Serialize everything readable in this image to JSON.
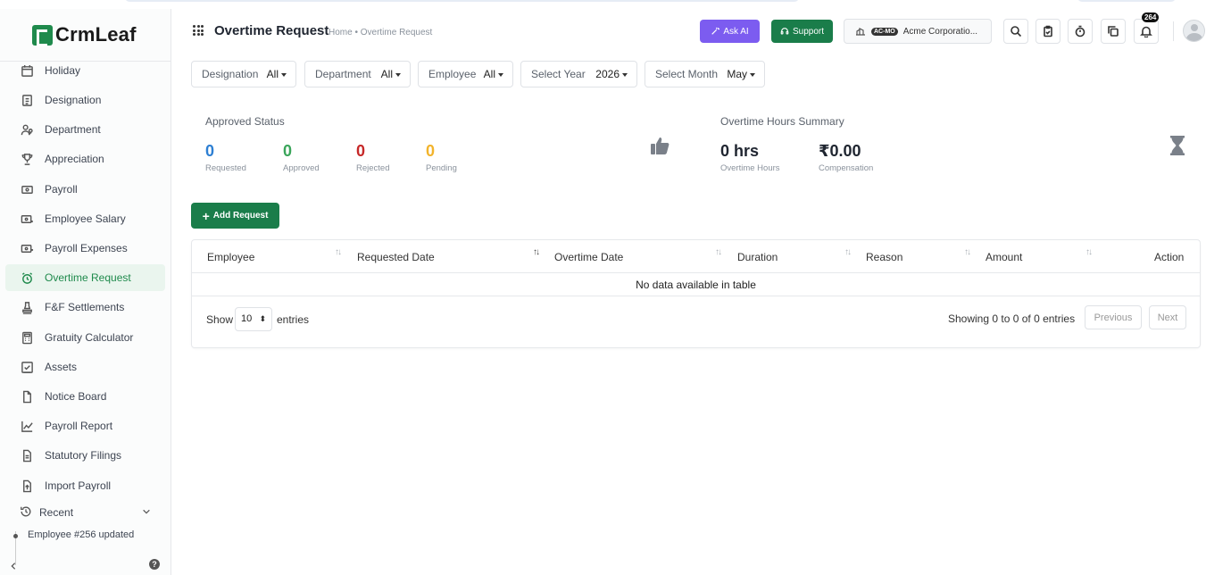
{
  "app": {
    "brand": "CrmLeaf"
  },
  "sidebar": {
    "items": [
      {
        "label": "Holiday",
        "icon": "calendar-icon"
      },
      {
        "label": "Designation",
        "icon": "id-card-icon"
      },
      {
        "label": "Department",
        "icon": "users-icon"
      },
      {
        "label": "Appreciation",
        "icon": "trophy-icon"
      },
      {
        "label": "Payroll",
        "icon": "money-icon"
      },
      {
        "label": "Employee Salary",
        "icon": "salary-icon"
      },
      {
        "label": "Payroll Expenses",
        "icon": "expenses-icon"
      },
      {
        "label": "Overtime Request",
        "icon": "alarm-clock-icon",
        "active": true
      },
      {
        "label": "F&F Settlements",
        "icon": "stamp-icon"
      },
      {
        "label": "Gratuity Calculator",
        "icon": "calculator-icon"
      },
      {
        "label": "Assets",
        "icon": "check-square-icon"
      },
      {
        "label": "Notice Board",
        "icon": "file-icon"
      },
      {
        "label": "Payroll Report",
        "icon": "chart-line-icon"
      },
      {
        "label": "Statutory Filings",
        "icon": "document-icon"
      },
      {
        "label": "Import Payroll",
        "icon": "upload-file-icon"
      }
    ],
    "recent_label": "Recent",
    "recent_items": [
      "Employee #256 updated"
    ]
  },
  "header": {
    "title": "Overtime Request",
    "breadcrumb": "Home • Overtime Request",
    "ask_ai": "Ask AI",
    "support": "Support",
    "company_badge": "AC-MO",
    "company_name": "Acme Corporatio...",
    "notification_count": "264"
  },
  "filters": [
    {
      "label": "Designation",
      "value": "All"
    },
    {
      "label": "Department",
      "value": "All"
    },
    {
      "label": "Employee",
      "value": "All"
    },
    {
      "label": "Select Year",
      "value": "2026"
    },
    {
      "label": "Select Month",
      "value": "May"
    }
  ],
  "approved_status": {
    "title": "Approved Status",
    "stats": [
      {
        "value": "0",
        "label": "Requested",
        "color": "#2d7fd3"
      },
      {
        "value": "0",
        "label": "Approved",
        "color": "#3aa55a"
      },
      {
        "value": "0",
        "label": "Rejected",
        "color": "#c62828"
      },
      {
        "value": "0",
        "label": "Pending",
        "color": "#f2b32b"
      }
    ]
  },
  "overtime_summary": {
    "title": "Overtime Hours Summary",
    "hours_value": "0 hrs",
    "hours_label": "Overtime Hours",
    "comp_value": "₹0.00",
    "comp_label": "Compensation"
  },
  "add_request": "Add Request",
  "table": {
    "columns": [
      "Employee",
      "Requested Date",
      "Overtime Date",
      "Duration",
      "Reason",
      "Amount",
      "Action"
    ],
    "empty_message": "No data available in table",
    "show_label": "Show",
    "page_size": "10",
    "entries_label": "entries",
    "showing": "Showing 0 to 0 of 0 entries",
    "previous": "Previous",
    "next": "Next"
  },
  "colors": {
    "brand_green": "#1a7d4a",
    "ai_purple": "#7c5cf0"
  }
}
